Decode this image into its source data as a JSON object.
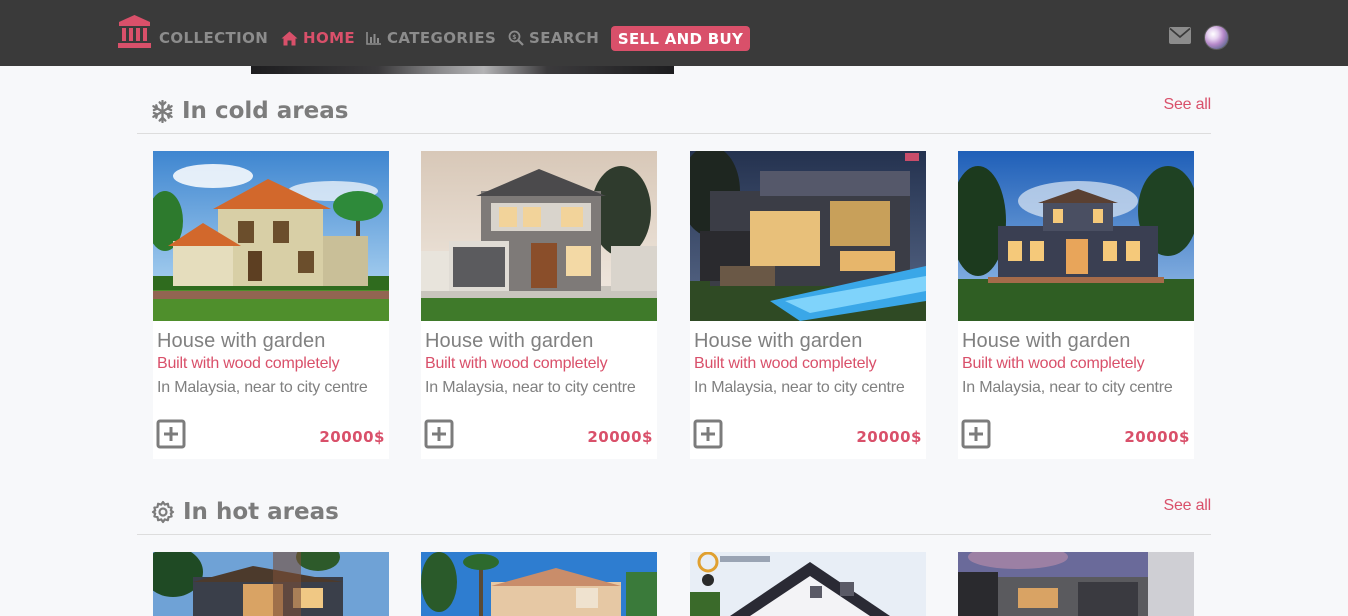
{
  "nav": {
    "logo_icon": "bank-icon",
    "items": [
      {
        "label": "COLLECTION",
        "icon": null,
        "active": false
      },
      {
        "label": "HOME",
        "icon": "home-icon",
        "active": true
      },
      {
        "label": "CATEGORIES",
        "icon": "bar-chart-icon",
        "active": false
      },
      {
        "label": "SEARCH",
        "icon": "search-icon",
        "active": false
      }
    ],
    "sell_button": "SELL AND BUY",
    "mail_icon": "envelope-icon",
    "avatar_icon": "user-avatar"
  },
  "sections": [
    {
      "icon": "snowflake-icon",
      "title": "In cold areas",
      "see_all": "See all",
      "cards": [
        {
          "title": "House with garden",
          "subtitle": "Built with wood completely",
          "location": "In Malaysia, near to city centre",
          "price": "20000$"
        },
        {
          "title": "House with garden",
          "subtitle": "Built with wood completely",
          "location": "In Malaysia, near to city centre",
          "price": "20000$"
        },
        {
          "title": "House with garden",
          "subtitle": "Built with wood completely",
          "location": "In Malaysia, near to city centre",
          "price": "20000$"
        },
        {
          "title": "House with garden",
          "subtitle": "Built with wood completely",
          "location": "In Malaysia, near to city centre",
          "price": "20000$"
        }
      ]
    },
    {
      "icon": "gear-icon",
      "title": "In hot areas",
      "see_all": "See all",
      "cards": []
    }
  ],
  "colors": {
    "accent": "#d9506a",
    "navbar": "#3a3a3a",
    "muted_text": "#808080",
    "page_bg": "#f7f8fa"
  }
}
